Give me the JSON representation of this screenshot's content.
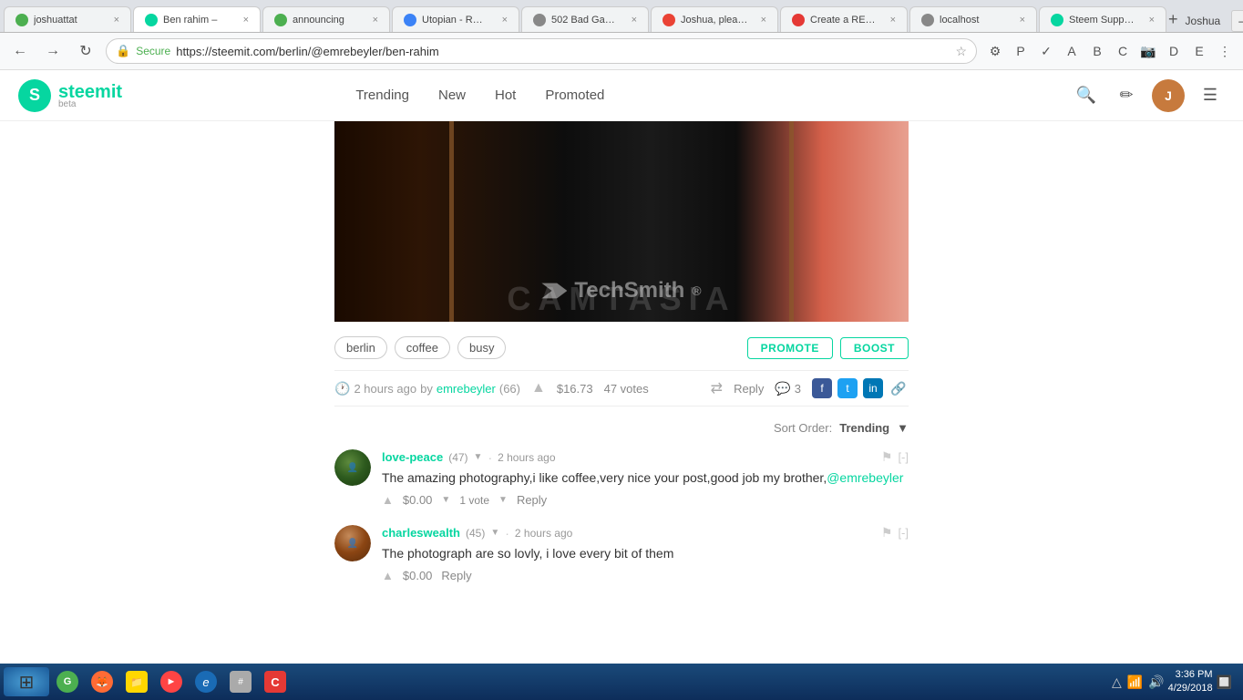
{
  "browser": {
    "tabs": [
      {
        "id": "tab-joshuattat",
        "label": "joshuattat",
        "favicon_color": "#4CAF50",
        "active": false
      },
      {
        "id": "tab-ben-rahim",
        "label": "Ben rahim –",
        "favicon_color": "#06d6a0",
        "active": true
      },
      {
        "id": "tab-announcing",
        "label": "announcing",
        "favicon_color": "#4CAF50",
        "active": false
      },
      {
        "id": "tab-utopian",
        "label": "Utopian - R…",
        "favicon_color": "#3b82f6",
        "active": false
      },
      {
        "id": "tab-502bad",
        "label": "502 Bad Ga…",
        "favicon_color": "#888",
        "active": false
      },
      {
        "id": "tab-joshua-gm",
        "label": "Joshua, plea…",
        "favicon_color": "#EA4335",
        "active": false
      },
      {
        "id": "tab-create-re",
        "label": "Create a RE…",
        "favicon_color": "#e53935",
        "active": false
      },
      {
        "id": "tab-localhost",
        "label": "localhost",
        "favicon_color": "#888",
        "active": false
      },
      {
        "id": "tab-steem-supp",
        "label": "Steem Supp…",
        "favicon_color": "#06d6a0",
        "active": false
      }
    ],
    "address_bar": "https://steemit.com/berlin/@emrebeyler/ben-rahim",
    "secure_label": "Secure",
    "top_right_user": "Joshua"
  },
  "steemit": {
    "logo_text": "steemit",
    "logo_beta": "beta",
    "nav": [
      {
        "label": "Trending"
      },
      {
        "label": "New"
      },
      {
        "label": "Hot"
      },
      {
        "label": "Promoted"
      }
    ]
  },
  "post": {
    "tags": [
      "berlin",
      "coffee",
      "busy"
    ],
    "promote_button": "PROMOTE",
    "boost_button": "BOOST",
    "time_ago": "2 hours ago",
    "by_text": "by",
    "author": "emrebeyler",
    "author_rep": "(66)",
    "value": "$16.73",
    "votes": "47 votes",
    "reply_label": "Reply",
    "comments_count": "3",
    "social_icons": [
      "f",
      "t",
      "in",
      "🔗"
    ],
    "sort_label": "Sort Order:",
    "sort_value": "Trending"
  },
  "comments": [
    {
      "id": "comment-1",
      "author": "love-peace",
      "rep": "(47)",
      "time_ago": "2 hours ago",
      "text": "The amazing photography,i like coffee,very nice your post,good job my brother,",
      "mention": "@emrebeyler",
      "value": "$0.00",
      "votes": "1 vote",
      "reply_label": "Reply",
      "avatar_bg": "#2d4a2d"
    },
    {
      "id": "comment-2",
      "author": "charleswealth",
      "rep": "(45)",
      "time_ago": "2 hours ago",
      "text": "The photograph are so lovly, i love every bit of them",
      "mention": "",
      "value": "$0.00",
      "votes": "",
      "reply_label": "Reply",
      "avatar_bg": "#8B4513"
    }
  ],
  "taskbar": {
    "clock_time": "3:36 PM",
    "clock_date": "4/29/2018",
    "start_icon": "⊞",
    "apps": [
      {
        "name": "chrome",
        "color": "#4CAF50",
        "icon": "●"
      },
      {
        "name": "firefox",
        "color": "#FF6B35",
        "icon": "●"
      },
      {
        "name": "files",
        "color": "#FFD700",
        "icon": "●"
      },
      {
        "name": "media",
        "color": "#FF4444",
        "icon": "►"
      },
      {
        "name": "ie",
        "color": "#1a6bb5",
        "icon": "e"
      },
      {
        "name": "calc",
        "color": "#aaa",
        "icon": "#"
      },
      {
        "name": "camtasia",
        "color": "#e53935",
        "icon": "C"
      }
    ]
  }
}
